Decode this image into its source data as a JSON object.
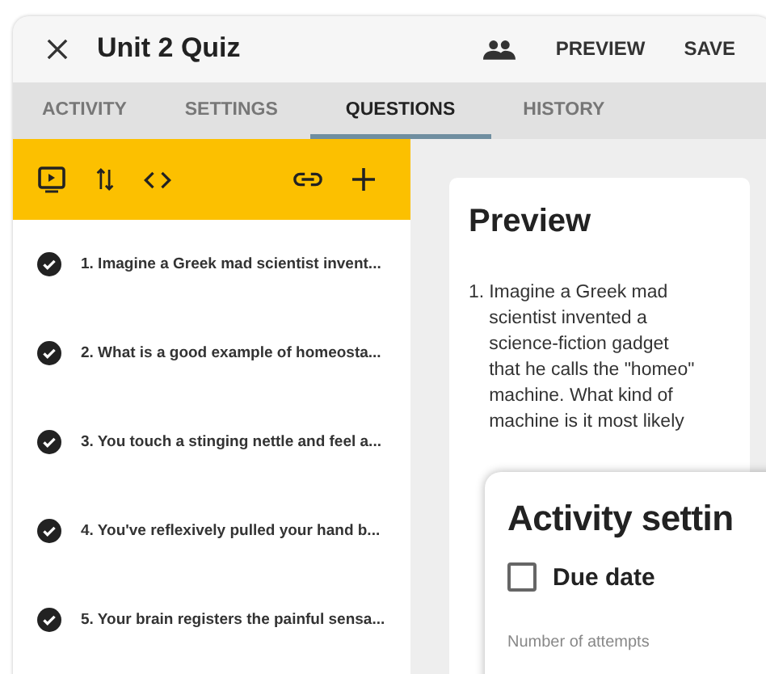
{
  "header": {
    "title": "Unit 2 Quiz",
    "actions": [
      "PREVIEW",
      "SAVE"
    ]
  },
  "tabs": [
    {
      "label": "ACTIVITY",
      "selected": false
    },
    {
      "label": "SETTINGS",
      "selected": false
    },
    {
      "label": "QUESTIONS",
      "selected": true
    },
    {
      "label": "HISTORY",
      "selected": false
    }
  ],
  "questions": [
    {
      "text": "1. Imagine a Greek mad scientist invent..."
    },
    {
      "text": "2. What is a good example of homeosta..."
    },
    {
      "text": "3. You touch a stinging nettle and feel a..."
    },
    {
      "text": "4. You've reflexively pulled your hand b..."
    },
    {
      "text": "5. Your brain registers the painful sensa..."
    }
  ],
  "preview": {
    "title": "Preview",
    "number": "1.",
    "text": "Imagine a Greek mad scientist invented a science-fiction gadget that he calls the \"homeo\" machine. What kind of machine is it most likely"
  },
  "dialog": {
    "title": "Activity settin",
    "due_date": {
      "label": "Due date",
      "checked": false
    },
    "attempts_label": "Number of attempts"
  }
}
